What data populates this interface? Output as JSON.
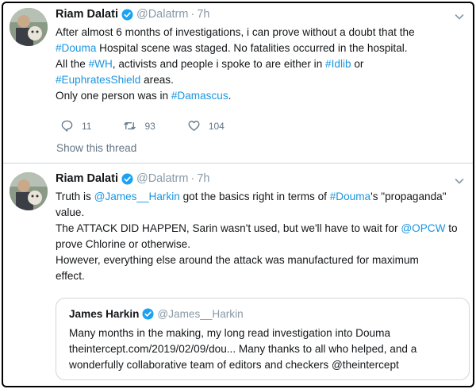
{
  "tweets": [
    {
      "author": {
        "name": "Riam Dalati",
        "handle": "@Dalatrm",
        "time": "7h"
      },
      "lines": [
        [
          {
            "t": "After almost 6 months of investigations, i can prove without a doubt that the",
            "link": false
          }
        ],
        [
          {
            "t": "#Douma",
            "link": true
          },
          {
            "t": " Hospital scene was staged. No fatalities occurred in the hospital.",
            "link": false
          }
        ],
        [
          {
            "t": "All the ",
            "link": false
          },
          {
            "t": "#WH",
            "link": true
          },
          {
            "t": ", activists and people i spoke to are either in ",
            "link": false
          },
          {
            "t": "#Idlib",
            "link": true
          },
          {
            "t": " or",
            "link": false
          }
        ],
        [
          {
            "t": "#EuphratesShield",
            "link": true
          },
          {
            "t": " areas.",
            "link": false
          }
        ],
        [
          {
            "t": "Only one person was in ",
            "link": false
          },
          {
            "t": "#Damascus",
            "link": true
          },
          {
            "t": ".",
            "link": false
          }
        ]
      ],
      "actions": {
        "replies": "11",
        "retweets": "93",
        "likes": "104"
      },
      "show_thread": "Show this thread"
    },
    {
      "author": {
        "name": "Riam Dalati",
        "handle": "@Dalatrm",
        "time": "7h"
      },
      "lines": [
        [
          {
            "t": "Truth is ",
            "link": false
          },
          {
            "t": "@James__Harkin",
            "link": true
          },
          {
            "t": " got the basics right in terms of ",
            "link": false
          },
          {
            "t": "#Douma",
            "link": true
          },
          {
            "t": "'s \"propaganda\"",
            "link": false
          }
        ],
        [
          {
            "t": "value.",
            "link": false
          }
        ],
        [
          {
            "t": "The ATTACK DID HAPPEN, Sarin wasn't used, but we'll have to wait for ",
            "link": false
          },
          {
            "t": "@OPCW",
            "link": true
          },
          {
            "t": " to",
            "link": false
          }
        ],
        [
          {
            "t": "prove Chlorine or otherwise.",
            "link": false
          }
        ],
        [
          {
            "t": "However, everything else around the attack was manufactured for maximum",
            "link": false
          }
        ],
        [
          {
            "t": "effect.",
            "link": false
          }
        ]
      ],
      "quote": {
        "author": {
          "name": "James Harkin",
          "handle": "@James__Harkin"
        },
        "lines": [
          "Many months in the making, my long read investigation into Douma",
          "theintercept.com/2019/02/09/dou... Many thanks to all who helped, and a",
          "wonderfully collaborative team of editors and checkers @theintercept"
        ]
      }
    }
  ],
  "colors": {
    "link": "#1b95e0",
    "verified": "#1da1f2",
    "muted": "#657786"
  },
  "icons": [
    "verified-badge-icon",
    "chevron-down-icon",
    "reply-icon",
    "retweet-icon",
    "like-icon"
  ]
}
